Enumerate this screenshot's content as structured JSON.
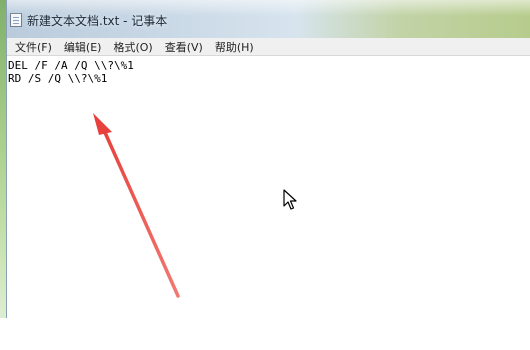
{
  "window": {
    "title": "新建文本文档.txt - 记事本",
    "app_icon": "notepad-icon"
  },
  "menu": {
    "items": [
      {
        "label": "文件(F)"
      },
      {
        "label": "编辑(E)"
      },
      {
        "label": "格式(O)"
      },
      {
        "label": "查看(V)"
      },
      {
        "label": "帮助(H)"
      }
    ]
  },
  "editor": {
    "lines": [
      "DEL /F /A /Q \\\\?\\%1",
      "RD /S /Q \\\\?\\%1"
    ]
  },
  "annotation": {
    "color": "#e8403c",
    "icon": "red-arrow-pointer"
  },
  "cursor": {
    "icon": "mouse-cursor-icon"
  },
  "colors": {
    "menubar": "#f0f0f0",
    "editor_bg": "#ffffff"
  }
}
